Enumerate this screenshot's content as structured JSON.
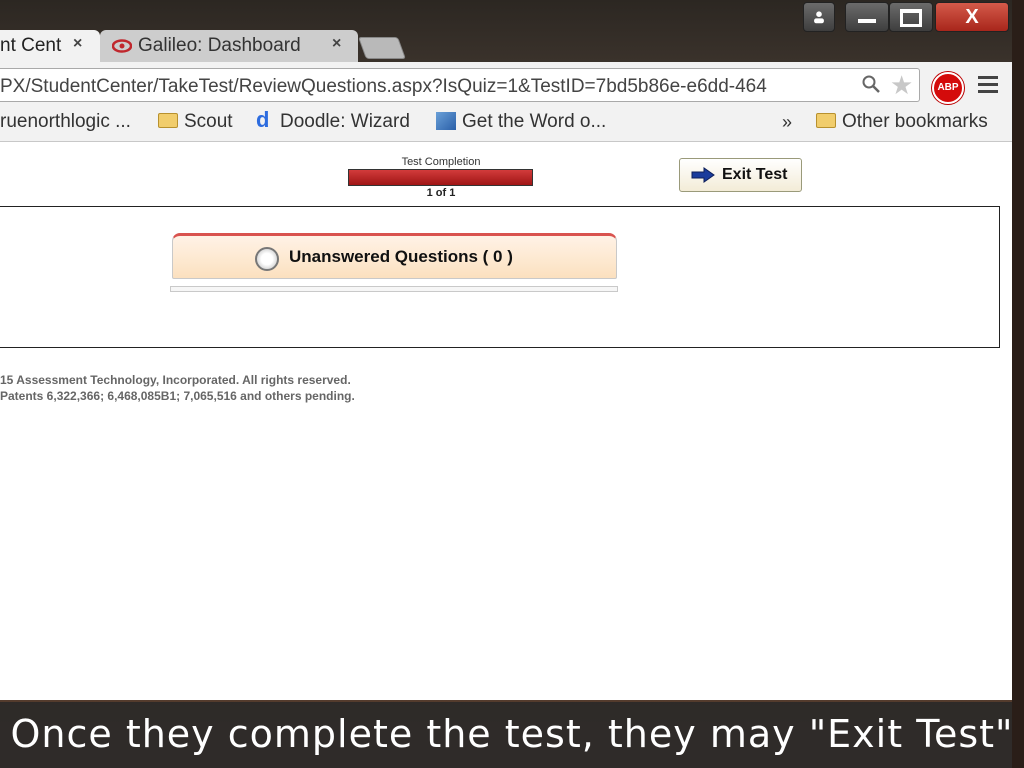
{
  "browser": {
    "tabs": [
      {
        "label": "nt Cent",
        "close": "×",
        "active": true
      },
      {
        "label": "Galileo: Dashboard",
        "close": "×",
        "active": false
      }
    ],
    "window_controls": {
      "user": "👤",
      "minimize": "—",
      "maximize": "▭",
      "close": "X"
    },
    "url": "PX/StudentCenter/TakeTest/ReviewQuestions.aspx?IsQuiz=1&TestID=7bd5b86e-e6dd-464",
    "extension_badge": "ABP",
    "bookmarks": [
      {
        "label": "ruenorthlogic ...",
        "icon": "none"
      },
      {
        "label": "Scout",
        "icon": "folder-icon"
      },
      {
        "label": "Doodle: Wizard",
        "icon": "doodle-icon"
      },
      {
        "label": "Get the Word o...",
        "icon": "word-icon"
      }
    ],
    "more_bookmarks": "»",
    "other_bookmarks": "Other bookmarks"
  },
  "test": {
    "progress_title": "Test Completion",
    "progress_count": "1 of 1",
    "progress_fraction": 1.0,
    "exit_label": "Exit Test",
    "unanswered_label": "Unanswered Questions ( 0 )"
  },
  "footer": {
    "line1": "15 Assessment Technology, Incorporated. All rights reserved.",
    "line2": "Patents 6,322,366; 6,468,085B1; 7,065,516 and others pending."
  },
  "caption": "Once they complete the test, they may \"Exit Test\"",
  "colors": {
    "progress": "#b01c1c",
    "accent_red": "#d9534f",
    "caption_bg": "#2f2f2f"
  }
}
